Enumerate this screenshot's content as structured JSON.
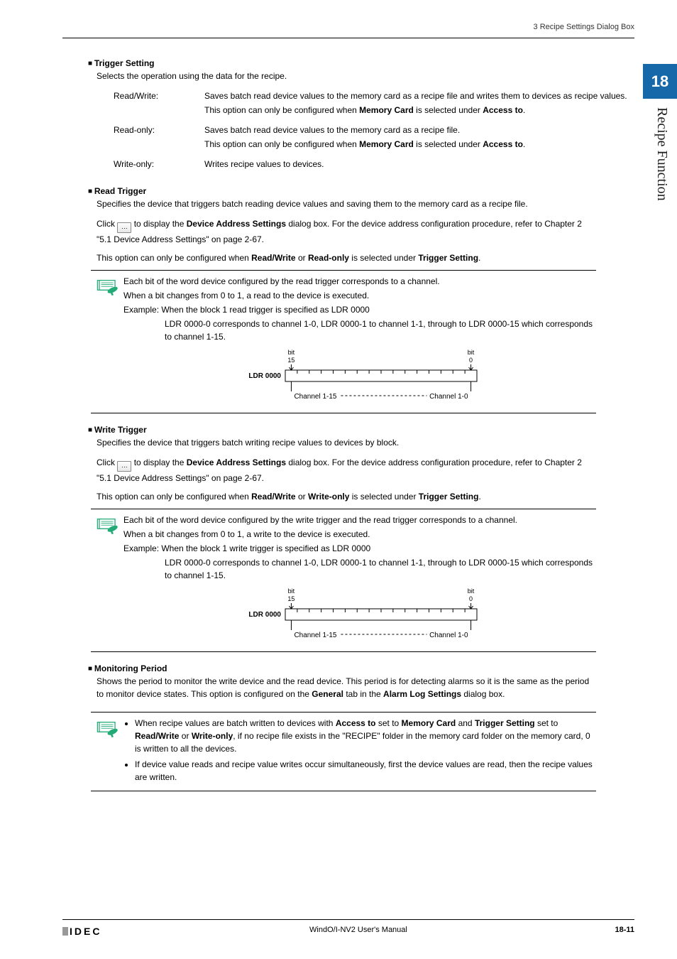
{
  "header": {
    "breadcrumb": "3 Recipe Settings Dialog Box"
  },
  "side_tab": {
    "number": "18",
    "label": "Recipe Function"
  },
  "trigger_setting": {
    "heading": "Trigger Setting",
    "intro": "Selects the operation using the data for the recipe.",
    "rows": [
      {
        "term": "Read/Write:",
        "lines": [
          "Saves batch read device values to the memory card as a recipe file and writes them to devices as recipe values.",
          "This option can only be configured when <b>Memory Card</b> is selected under <b>Access to</b>."
        ]
      },
      {
        "term": "Read-only:",
        "lines": [
          "Saves batch read device values to the memory card as a recipe file.",
          "This option can only be configured when <b>Memory Card</b> is selected under <b>Access to</b>."
        ]
      },
      {
        "term": "Write-only:",
        "lines": [
          "Writes recipe values to devices."
        ]
      }
    ]
  },
  "read_trigger": {
    "heading": "Read Trigger",
    "intro": "Specifies the device that triggers batch reading device values and saving them to the memory card as a recipe file.",
    "click_line_pre": "Click ",
    "click_line_post": " to display the <b>Device Address Settings</b> dialog box. For the device address configuration procedure, refer to Chapter 2 \"5.1 Device Address Settings\" on page 2-67.",
    "option_line": "This option can only be configured when <b>Read/Write</b> or <b>Read-only</b> is selected under <b>Trigger Setting</b>.",
    "note": {
      "p1": "Each bit of the word device configured by the read trigger corresponds to a channel.",
      "p2": "When a bit changes from 0 to 1, a read to the device is executed.",
      "ex_lead": "Example: When the block 1 read trigger is specified as LDR 0000",
      "ex_body": "LDR 0000-0 corresponds to channel 1-0, LDR 0000-1 to channel 1-1, through to LDR 0000-15 which corresponds to channel 1-15."
    }
  },
  "write_trigger": {
    "heading": "Write Trigger",
    "intro": "Specifies the device that triggers batch writing recipe values to devices by block.",
    "click_line_pre": "Click ",
    "click_line_post": " to display the <b>Device Address Settings</b> dialog box. For the device address configuration procedure, refer to Chapter 2 \"5.1 Device Address Settings\" on page 2-67.",
    "option_line": "This option can only be configured when <b>Read/Write</b> or <b>Write-only</b> is selected under <b>Trigger Setting</b>.",
    "note": {
      "p1": "Each bit of the word device configured by the write trigger and the read trigger corresponds to a channel.",
      "p2": "When a bit changes from 0 to 1, a write to the device is executed.",
      "ex_lead": "Example: When the block 1 write trigger is specified as LDR 0000",
      "ex_body": "LDR 0000-0 corresponds to channel 1-0, LDR 0000-1 to channel 1-1, through to LDR 0000-15 which corresponds to channel 1-15."
    }
  },
  "diagram": {
    "bit15": "bit\n15",
    "bit0": "bit\n0",
    "ldr": "LDR 0000",
    "ch15": "Channel 1-15",
    "ch0": "Channel 1-0"
  },
  "monitoring_period": {
    "heading": "Monitoring Period",
    "text": "Shows the period to monitor the write device and the read device. This period is for detecting alarms so it is the same as the period to monitor device states. This option is configured on the <b>General</b> tab in the <b>Alarm Log Settings</b> dialog box."
  },
  "final_note": {
    "bullets": [
      "When recipe values are batch written to devices with <b>Access to</b> set to <b>Memory Card</b> and <b>Trigger Setting</b> set to <b>Read/Write</b> or <b>Write-only</b>, if no recipe file exists in the \"RECIPE\" folder in the memory card folder on the memory card, 0 is written to all the devices.",
      "If device value reads and recipe value writes occur simultaneously, first the device values are read, then the recipe values are written."
    ]
  },
  "footer": {
    "logo": "IDEC",
    "center": "WindO/I-NV2 User's Manual",
    "page": "18-11"
  }
}
